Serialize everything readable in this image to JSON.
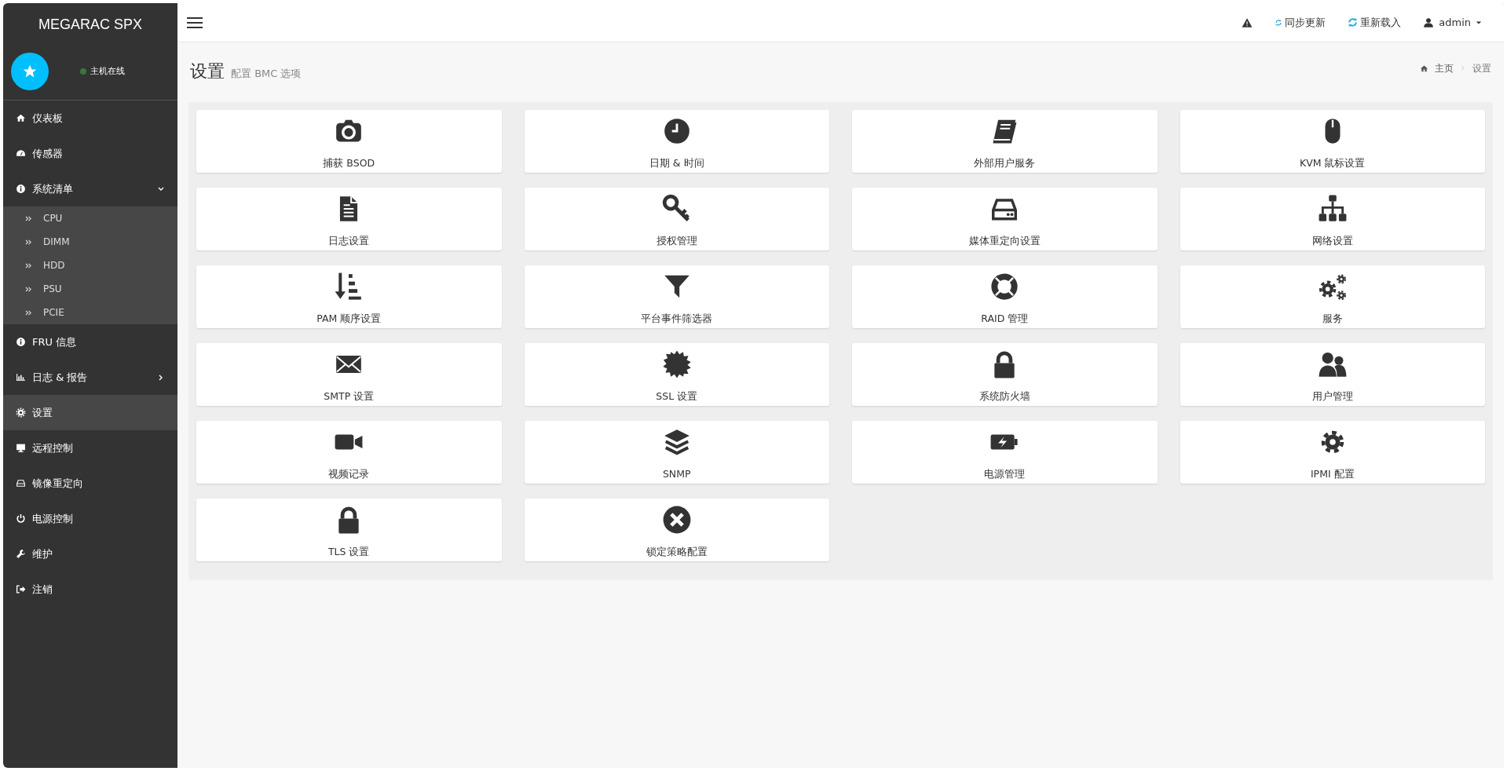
{
  "brand": "MEGARAC SPX",
  "host_status": {
    "label": "主机在线",
    "online": true
  },
  "sidebar": {
    "items": [
      {
        "label": "仪表板",
        "kind": "link",
        "selected": false
      },
      {
        "label": "传感器",
        "kind": "link",
        "selected": false
      },
      {
        "label": "系统清单",
        "kind": "group",
        "selected": false,
        "expanded": true,
        "children": [
          {
            "label": "CPU",
            "selected": false
          },
          {
            "label": "DIMM",
            "selected": false
          },
          {
            "label": "HDD",
            "selected": false
          },
          {
            "label": "PSU",
            "selected": false
          },
          {
            "label": "PCIE",
            "selected": false
          }
        ]
      },
      {
        "label": "FRU 信息",
        "kind": "link",
        "selected": false
      },
      {
        "label": "日志 & 报告",
        "kind": "group",
        "selected": false,
        "expanded": false
      },
      {
        "label": "设置",
        "kind": "link",
        "selected": true
      },
      {
        "label": "远程控制",
        "kind": "link",
        "selected": false
      },
      {
        "label": "镜像重定向",
        "kind": "link",
        "selected": false
      },
      {
        "label": "电源控制",
        "kind": "link",
        "selected": false
      },
      {
        "label": "维护",
        "kind": "link",
        "selected": false
      },
      {
        "label": "注销",
        "kind": "link",
        "selected": false
      }
    ]
  },
  "header": {
    "links": [
      "同步更新",
      "重新载入"
    ],
    "user": "admin"
  },
  "page": {
    "title": "设置",
    "subtitle": "配置 BMC 选项",
    "breadcrumb": [
      "主页",
      "设置"
    ]
  },
  "tiles": [
    {
      "label": "捕获 BSOD"
    },
    {
      "label": "日期 & 时间"
    },
    {
      "label": "外部用户服务"
    },
    {
      "label": "KVM 鼠标设置"
    },
    {
      "label": "日志设置"
    },
    {
      "label": "授权管理"
    },
    {
      "label": "媒体重定向设置"
    },
    {
      "label": "网络设置"
    },
    {
      "label": "PAM 顺序设置"
    },
    {
      "label": "平台事件筛选器"
    },
    {
      "label": "RAID 管理"
    },
    {
      "label": "服务"
    },
    {
      "label": "SMTP 设置"
    },
    {
      "label": "SSL 设置"
    },
    {
      "label": "系统防火墙"
    },
    {
      "label": "用户管理"
    },
    {
      "label": "视频记录"
    },
    {
      "label": "SNMP"
    },
    {
      "label": "电源管理"
    },
    {
      "label": "IPMI 配置"
    },
    {
      "label": "TLS 设置"
    },
    {
      "label": "锁定策略配置"
    }
  ]
}
